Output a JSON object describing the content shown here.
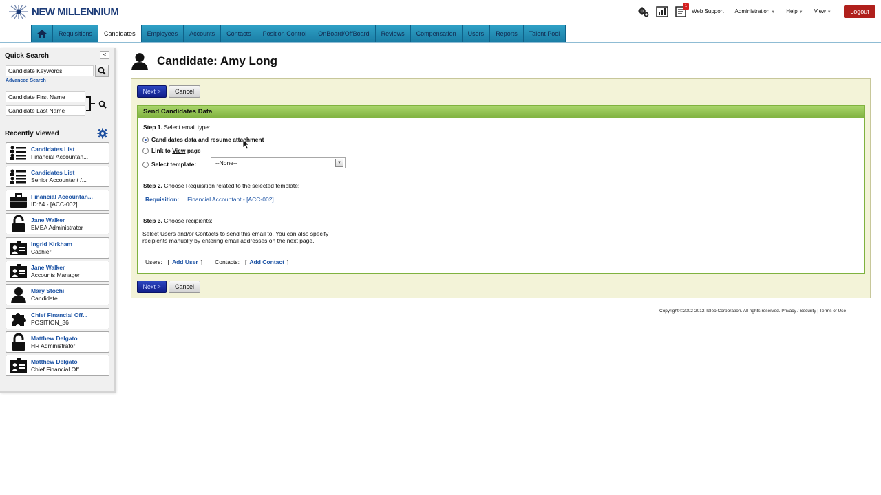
{
  "brand": {
    "name": "NEW MILLENNIUM"
  },
  "header": {
    "links": [
      {
        "label": "Web Support"
      },
      {
        "label": "Administration"
      },
      {
        "label": "Help"
      },
      {
        "label": "View"
      }
    ],
    "logout": "Logout",
    "icons": [
      "tools-icon",
      "report-icon",
      "tasks-icon"
    ],
    "task_badge": "1"
  },
  "tabs": [
    {
      "label": ""
    },
    {
      "label": "Requisitions"
    },
    {
      "label": "Candidates"
    },
    {
      "label": "Employees"
    },
    {
      "label": "Accounts"
    },
    {
      "label": "Contacts"
    },
    {
      "label": "Position Control"
    },
    {
      "label": "OnBoard/OffBoard"
    },
    {
      "label": "Reviews"
    },
    {
      "label": "Compensation"
    },
    {
      "label": "Users"
    },
    {
      "label": "Reports"
    },
    {
      "label": "Talent Pool"
    }
  ],
  "active_tab": "Candidates",
  "sidebar": {
    "collapse_label": "<",
    "quick_search": {
      "title": "Quick Search",
      "keywords_placeholder": "Candidate Keywords",
      "advanced": "Advanced Search",
      "first_name_placeholder": "Candidate First Name",
      "last_name_placeholder": "Candidate Last Name"
    },
    "recent_title": "Recently Viewed",
    "recent": [
      {
        "name": "Candidates List",
        "sub": "Financial Accountan...",
        "icon": "list-icon"
      },
      {
        "name": "Candidates List",
        "sub": "Senior Accountant /...",
        "icon": "list-icon"
      },
      {
        "name": "Financial Accountan...",
        "sub": "ID:64 - [ACC-002]",
        "icon": "briefcase-icon"
      },
      {
        "name": "Jane Walker",
        "sub": "EMEA Administrator",
        "icon": "lock-icon"
      },
      {
        "name": "Ingrid Kirkham",
        "sub": "Cashier",
        "icon": "id-card-icon"
      },
      {
        "name": "Jane Walker",
        "sub": "Accounts Manager",
        "icon": "id-card-icon"
      },
      {
        "name": "Mary Stochi",
        "sub": "Candidate",
        "icon": "person-icon"
      },
      {
        "name": "Chief Financial Off...",
        "sub": "POSITION_36",
        "icon": "puzzle-icon"
      },
      {
        "name": "Matthew Delgato",
        "sub": "HR Administrator",
        "icon": "lock-icon"
      },
      {
        "name": "Matthew Delgato",
        "sub": "Chief Financial Off...",
        "icon": "id-card-icon"
      }
    ]
  },
  "main": {
    "title": "Candidate: Amy Long",
    "buttons": {
      "next": "Next >",
      "cancel": "Cancel"
    },
    "section_title": "Send Candidates Data",
    "step1": {
      "label": "Step 1.",
      "text": "Select email type:"
    },
    "options": [
      {
        "label": "Candidates data and resume attachment",
        "selected": true
      },
      {
        "label_pre": "Link to ",
        "label_u": "View",
        "label_post": " page",
        "selected": false
      },
      {
        "label": "Select template:",
        "selected": false
      }
    ],
    "template_select": {
      "value": "--None--"
    },
    "step2": {
      "label": "Step 2.",
      "text": "Choose Requisition related to the selected template:"
    },
    "requisition": {
      "label": "Requisition:",
      "value": "Financial Accountant - [ACC-002]"
    },
    "step3": {
      "label": "Step 3.",
      "text": "Choose recipients:"
    },
    "instructions": "Select Users and/or Contacts to send this email to. You can also specify recipients manually by entering email addresses on the next page.",
    "recipients": {
      "users_label": "Users:",
      "add_user": "Add User",
      "contacts_label": "Contacts:",
      "add_contact": "Add Contact",
      "open_bracket": "[",
      "close_bracket": "]"
    }
  },
  "footer": {
    "copyright": "Copyright ©2002-2012 Taleo Corporation. All rights reserved. Privacy / Security | Terms of Use"
  },
  "colors": {
    "tab_blue": "#1b7ea6",
    "link_blue": "#1f55a5",
    "logout_red": "#b0201c",
    "panel_bg": "#f3f3d8",
    "section_green": "#7fb23f"
  }
}
